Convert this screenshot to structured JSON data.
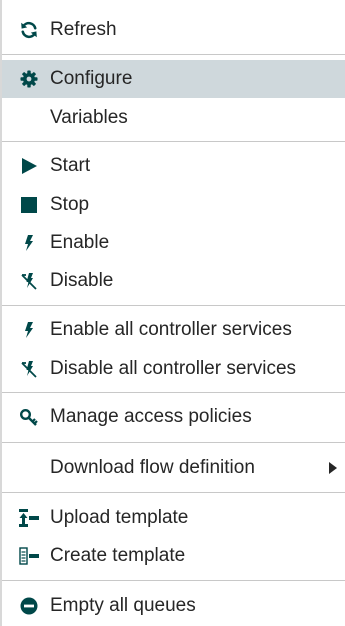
{
  "menu": {
    "items": [
      {
        "label": "Refresh",
        "icon": "refresh-icon"
      },
      {
        "label": "Configure",
        "icon": "gear-icon",
        "active": true
      },
      {
        "label": "Variables",
        "icon": ""
      },
      {
        "label": "Start",
        "icon": "play-icon"
      },
      {
        "label": "Stop",
        "icon": "stop-icon"
      },
      {
        "label": "Enable",
        "icon": "bolt-icon"
      },
      {
        "label": "Disable",
        "icon": "bolt-off-icon"
      },
      {
        "label": "Enable all controller services",
        "icon": "bolt-icon"
      },
      {
        "label": "Disable all controller services",
        "icon": "bolt-off-icon"
      },
      {
        "label": "Manage access policies",
        "icon": "key-icon"
      },
      {
        "label": "Download flow definition",
        "icon": "",
        "submenu": true
      },
      {
        "label": "Upload template",
        "icon": "upload-template-icon"
      },
      {
        "label": "Create template",
        "icon": "create-template-icon"
      },
      {
        "label": "Empty all queues",
        "icon": "minus-circle-icon"
      }
    ]
  },
  "colors": {
    "active_bg": "#cfd8dc",
    "icon": "#004849",
    "text": "#262626",
    "divider": "#c8c8c8"
  }
}
